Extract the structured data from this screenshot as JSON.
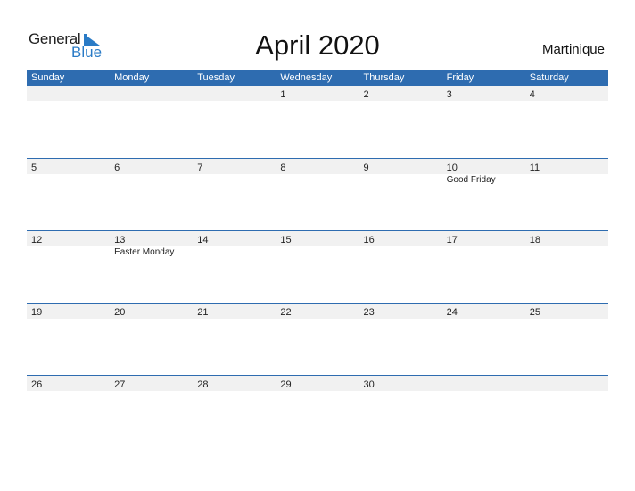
{
  "logo": {
    "general": "General",
    "blue": "Blue"
  },
  "title": "April 2020",
  "country": "Martinique",
  "colors": {
    "accent": "#2e6cb0",
    "strip": "#f1f1f1",
    "logo_blue": "#2a7bc6"
  },
  "weekdays": [
    "Sunday",
    "Monday",
    "Tuesday",
    "Wednesday",
    "Thursday",
    "Friday",
    "Saturday"
  ],
  "weeks": [
    {
      "days": [
        "",
        "",
        "",
        "1",
        "2",
        "3",
        "4"
      ],
      "holidays": [
        "",
        "",
        "",
        "",
        "",
        "",
        ""
      ]
    },
    {
      "days": [
        "5",
        "6",
        "7",
        "8",
        "9",
        "10",
        "11"
      ],
      "holidays": [
        "",
        "",
        "",
        "",
        "",
        "Good Friday",
        ""
      ]
    },
    {
      "days": [
        "12",
        "13",
        "14",
        "15",
        "16",
        "17",
        "18"
      ],
      "holidays": [
        "",
        "Easter Monday",
        "",
        "",
        "",
        "",
        ""
      ]
    },
    {
      "days": [
        "19",
        "20",
        "21",
        "22",
        "23",
        "24",
        "25"
      ],
      "holidays": [
        "",
        "",
        "",
        "",
        "",
        "",
        ""
      ]
    },
    {
      "days": [
        "26",
        "27",
        "28",
        "29",
        "30",
        "",
        ""
      ],
      "holidays": [
        "",
        "",
        "",
        "",
        "",
        "",
        ""
      ]
    }
  ]
}
